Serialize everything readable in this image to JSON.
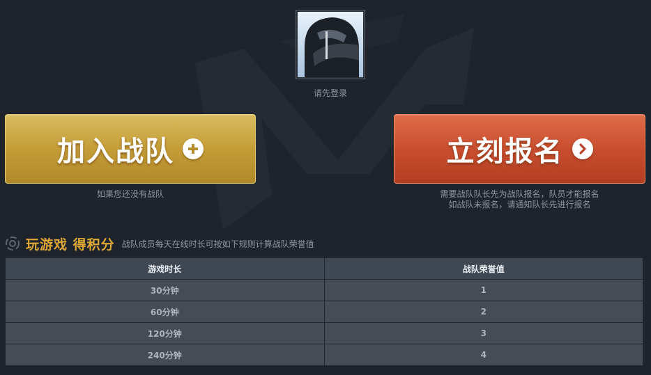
{
  "profile": {
    "login_hint": "请先登录"
  },
  "actions": {
    "join_team": {
      "label": "加入战队",
      "icon": "plus-circle-icon",
      "note": "如果您还没有战队"
    },
    "sign_up": {
      "label": "立刻报名",
      "icon": "chevron-right-circle-icon",
      "note_line1": "需要战队队长先为战队报名，队员才能报名",
      "note_line2": "如战队未报名，请通知队长先进行报名"
    }
  },
  "section": {
    "title": "玩游戏 得积分",
    "description": "战队成员每天在线时长可按如下规则计算战队荣誉值"
  },
  "table": {
    "headers": [
      "游戏时长",
      "战队荣誉值"
    ],
    "rows": [
      [
        "30分钟",
        "1"
      ],
      [
        "60分钟",
        "2"
      ],
      [
        "120分钟",
        "3"
      ],
      [
        "240分钟",
        "4"
      ]
    ]
  },
  "colors": {
    "background": "#1f242c",
    "join_button": "#c49d37",
    "signup_button": "#c94e2f",
    "section_title": "#e0a834"
  }
}
